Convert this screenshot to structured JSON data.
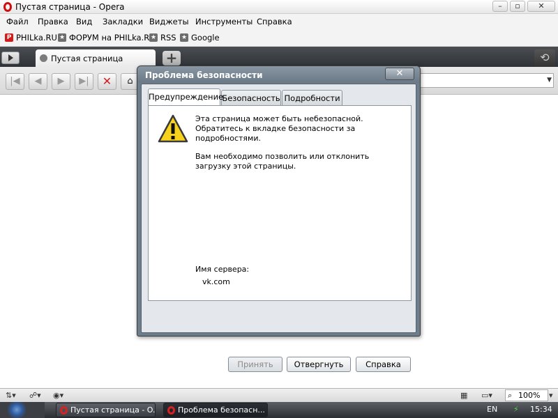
{
  "window": {
    "title": "Пустая страница - Opera"
  },
  "menu": [
    "Файл",
    "Правка",
    "Вид",
    "Закладки",
    "Виджеты",
    "Инструменты",
    "Справка"
  ],
  "bookmarks": [
    {
      "label": "PHILka.RU",
      "icon": "philka-favicon-icon"
    },
    {
      "label": "ФОРУМ на PHILka.RU",
      "icon": "star-bookmark-icon"
    },
    {
      "label": "RSS",
      "icon": "star-bookmark-icon"
    },
    {
      "label": "Google",
      "icon": "star-bookmark-icon"
    }
  ],
  "tabs": [
    {
      "label": "Пустая страница"
    }
  ],
  "dialog": {
    "title": "Проблема безопасности",
    "close": "✕",
    "tabs": [
      "Предупреждение",
      "Безопасность",
      "Подробности"
    ],
    "active_tab": "Предупреждение",
    "message_1": "Эта страница может быть небезопасной. Обратитесь к вкладке безопасности за подробностями.",
    "message_2": "Вам необходимо позволить или отклонить загрузку этой страницы.",
    "server_label": "Имя сервера:",
    "server_value": "vk.com",
    "buttons": {
      "accept": "Принять",
      "reject": "Отвергнуть",
      "help": "Справка"
    }
  },
  "statusbar": {
    "zoom": "100%"
  },
  "taskbar": {
    "tasks": [
      "Пустая страница - O...",
      "Проблема безопасн..."
    ],
    "lang": "EN",
    "time": "15:34"
  },
  "colors": {
    "stop_red": "#d41d1d",
    "warning_yellow": "#f6d21c",
    "opera_red": "#d10d0d"
  }
}
